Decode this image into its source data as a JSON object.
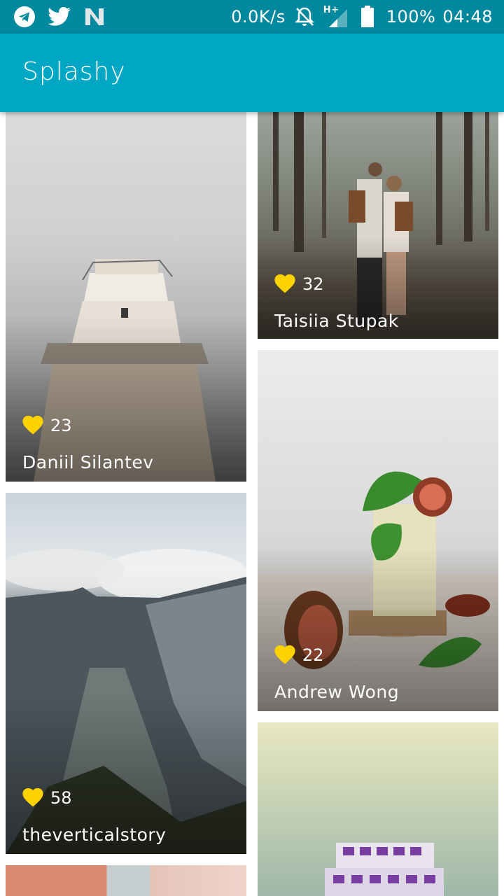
{
  "status_bar": {
    "net_speed": "0.0K/s",
    "network_type": "H+",
    "battery": "100%",
    "time": "04:48",
    "icons": [
      "telegram-icon",
      "twitter-icon",
      "n-app-icon",
      "bell-off-icon",
      "signal-icon",
      "battery-icon"
    ]
  },
  "app_bar": {
    "title": "Splashy"
  },
  "colors": {
    "status_bar": "#00889e",
    "app_bar": "#00a7c4",
    "heart": "#ffd200"
  },
  "photos": [
    {
      "likes": "23",
      "author": "Daniil Silantev"
    },
    {
      "likes": "32",
      "author": "Taisiia Stupak"
    },
    {
      "likes": "58",
      "author": "theverticalstory"
    },
    {
      "likes": "22",
      "author": "Andrew Wong"
    }
  ]
}
